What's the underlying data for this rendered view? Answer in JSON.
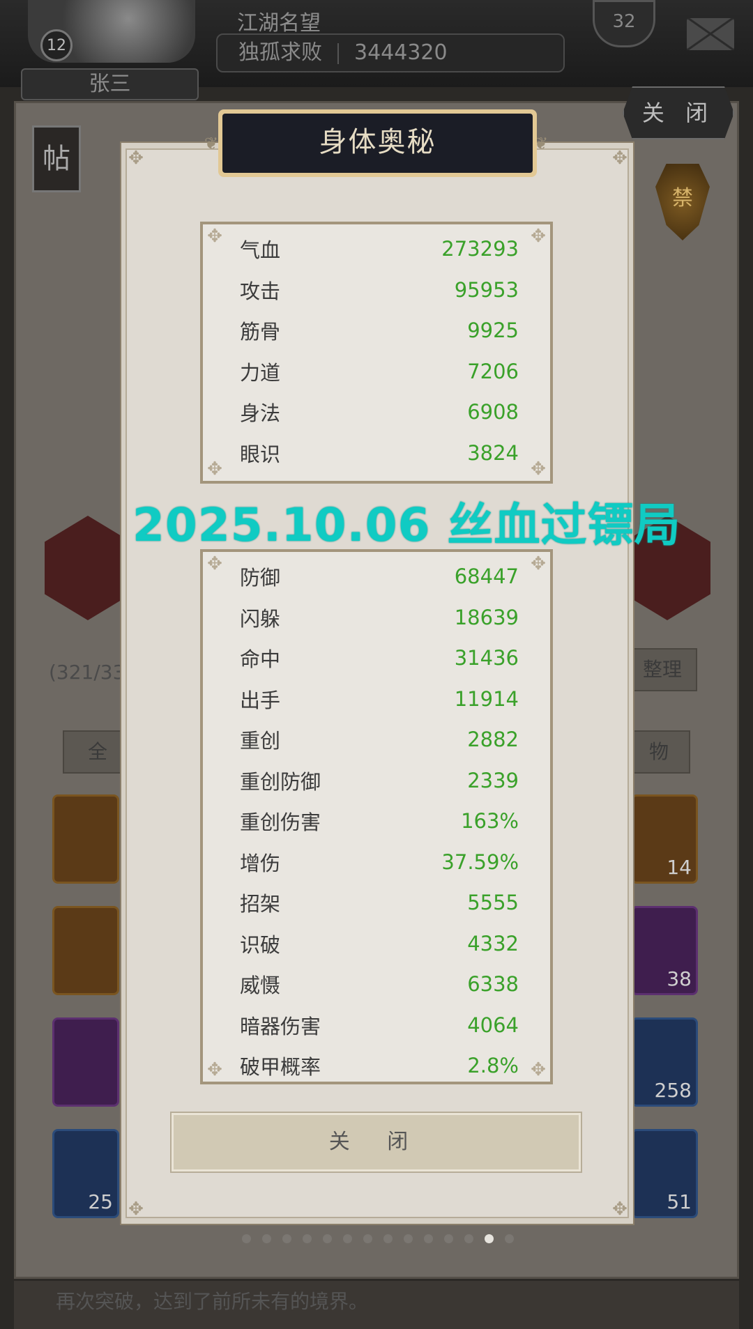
{
  "background": {
    "player_name": "张三",
    "player_level": "12",
    "fame_title": "江湖名望",
    "fame_rank": "独孤求败",
    "fame_value": "3444320",
    "badge_value": "32",
    "close_label": "关 闭",
    "tie_label": "帖",
    "ban_label": "禁",
    "count_text": "(321/33",
    "tidy_label": "整理",
    "filter_all": "全",
    "filter_obj": "物",
    "slot_counts": [
      "14",
      "38",
      "258",
      "51",
      "25"
    ],
    "bottom_text": "再次突破，达到了前所未有的境界。"
  },
  "modal": {
    "title": "身体奥秘",
    "top_stats": [
      {
        "label": "气血",
        "value": "273293"
      },
      {
        "label": "攻击",
        "value": "95953"
      },
      {
        "label": "筋骨",
        "value": "9925"
      },
      {
        "label": "力道",
        "value": "7206"
      },
      {
        "label": "身法",
        "value": "6908"
      },
      {
        "label": "眼识",
        "value": "3824"
      }
    ],
    "bottom_stats": [
      {
        "label": "防御",
        "value": "68447"
      },
      {
        "label": "闪躲",
        "value": "18639"
      },
      {
        "label": "命中",
        "value": "31436"
      },
      {
        "label": "出手",
        "value": "11914"
      },
      {
        "label": "重创",
        "value": "2882"
      },
      {
        "label": "重创防御",
        "value": "2339"
      },
      {
        "label": "重创伤害",
        "value": "163%"
      },
      {
        "label": "增伤",
        "value": "37.59%"
      },
      {
        "label": "招架",
        "value": "5555"
      },
      {
        "label": "识破",
        "value": "4332"
      },
      {
        "label": "威慑",
        "value": "6338"
      },
      {
        "label": "暗器伤害",
        "value": "4064"
      },
      {
        "label": "破甲概率",
        "value": "2.8%"
      }
    ],
    "close_button": "关  闭"
  },
  "watermark": "2025.10.06 丝血过镖局",
  "pager": {
    "total": 14,
    "active_index": 12
  },
  "colors": {
    "stat_value": "#3aa12a",
    "watermark": "#10cbc3",
    "title_plate": "#1b1d26",
    "title_border": "#e2c894"
  }
}
